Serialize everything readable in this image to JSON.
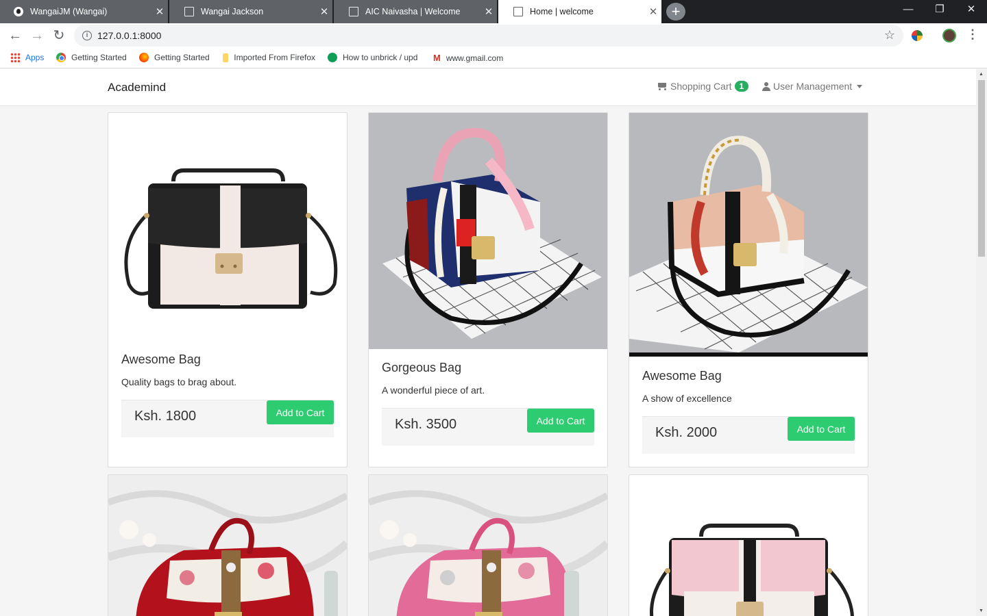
{
  "browser": {
    "tabs": [
      {
        "label": "WangaiJM (Wangai)",
        "icon": "github-icon",
        "active": false
      },
      {
        "label": "Wangai Jackson",
        "icon": "page-icon",
        "active": false
      },
      {
        "label": "AIC Naivasha | Welcome",
        "icon": "page-icon",
        "active": false
      },
      {
        "label": "Home | welcome",
        "icon": "page-icon",
        "active": true
      }
    ],
    "url": "127.0.0.1:8000",
    "bookmarks": [
      {
        "label": "Apps",
        "icon": "apps-grid-icon"
      },
      {
        "label": "Getting Started",
        "icon": "chrome-icon"
      },
      {
        "label": "Getting Started",
        "icon": "firefox-icon"
      },
      {
        "label": "Imported From Firefox",
        "icon": "folder-icon"
      },
      {
        "label": "How to unbrick / upd",
        "icon": "site-icon"
      },
      {
        "label": "www.gmail.com",
        "icon": "gmail-icon"
      }
    ]
  },
  "site": {
    "brand": "Academind",
    "cart_label": "Shopping Cart",
    "cart_count": "1",
    "user_menu": "User Management"
  },
  "products": [
    {
      "title": "Awesome Bag",
      "description": "Quality bags to brag about.",
      "price": "Ksh. 1800",
      "button": "Add to Cart",
      "style": "black-white"
    },
    {
      "title": "Gorgeous Bag",
      "description": "A wonderful piece of art.",
      "price": "Ksh. 3500",
      "button": "Add to Cart",
      "style": "navy-red-scarf"
    },
    {
      "title": "Awesome Bag",
      "description": "A show of excellence",
      "price": "Ksh. 2000",
      "button": "Add to Cart",
      "style": "peach-black-scarf"
    },
    {
      "style": "red-floral"
    },
    {
      "style": "pink-floral"
    },
    {
      "style": "pink-black-white"
    }
  ],
  "colors": {
    "accent_green": "#2ecc71",
    "badge_green": "#27ae60"
  }
}
